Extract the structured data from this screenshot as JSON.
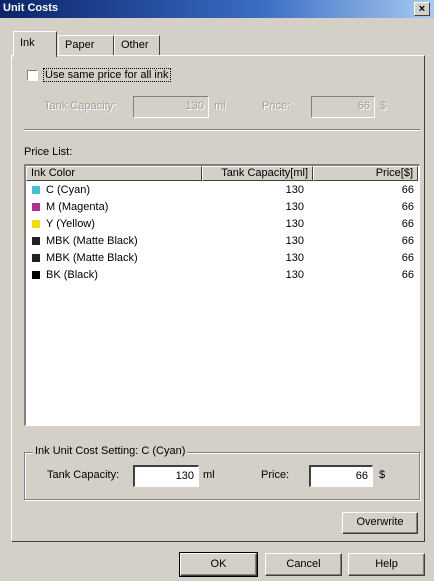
{
  "window": {
    "title": "Unit Costs",
    "close_glyph": "×"
  },
  "tabs": [
    {
      "label": "Ink",
      "active": true
    },
    {
      "label": "Paper",
      "active": false
    },
    {
      "label": "Other",
      "active": false
    }
  ],
  "same_price": {
    "checkbox_label": "Use same price for all ink",
    "checked": false,
    "tank_label": "Tank Capacity:",
    "tank_value": "130",
    "tank_unit": "ml",
    "price_label": "Price:",
    "price_value": "66",
    "price_unit": "$"
  },
  "price_list": {
    "label": "Price List:",
    "columns": [
      "Ink Color",
      "Tank Capacity[ml]",
      "Price[$]"
    ],
    "rows": [
      {
        "color": "C (Cyan)",
        "swatch": "#3fbfd8",
        "icon": "cyan-swatch-icon",
        "capacity": "130",
        "price": "66"
      },
      {
        "color": "M (Magenta)",
        "swatch": "#b03090",
        "icon": "magenta-swatch-icon",
        "capacity": "130",
        "price": "66"
      },
      {
        "color": "Y (Yellow)",
        "swatch": "#f0e000",
        "icon": "yellow-swatch-icon",
        "capacity": "130",
        "price": "66"
      },
      {
        "color": "MBK (Matte Black)",
        "swatch": "#202020",
        "icon": "matte-black-swatch-icon",
        "capacity": "130",
        "price": "66"
      },
      {
        "color": "MBK (Matte Black)",
        "swatch": "#202020",
        "icon": "matte-black-swatch-icon",
        "capacity": "130",
        "price": "66"
      },
      {
        "color": "BK (Black)",
        "swatch": "#000000",
        "icon": "black-swatch-icon",
        "capacity": "130",
        "price": "66"
      }
    ]
  },
  "unit_cost_setting": {
    "legend": "Ink Unit Cost Setting: C (Cyan)",
    "tank_label": "Tank Capacity:",
    "tank_value": "130",
    "tank_unit": "ml",
    "price_label": "Price:",
    "price_value": "66",
    "price_unit": "$"
  },
  "buttons": {
    "overwrite": "Overwrite",
    "ok": "OK",
    "cancel": "Cancel",
    "help": "Help"
  }
}
